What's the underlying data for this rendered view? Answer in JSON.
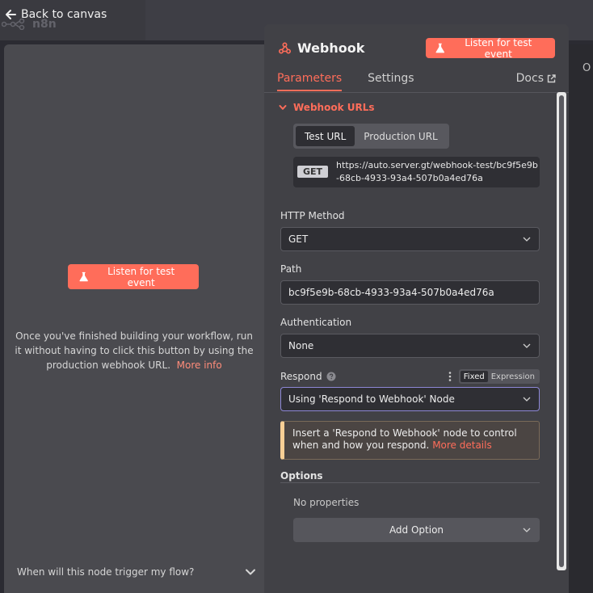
{
  "topbar": {
    "back_label": "Back to canvas",
    "logo_text": "n8n"
  },
  "left_panel": {
    "listen_button": "Listen for test event",
    "description": "Once you've finished building your workflow, run it without having to click this button by using the production webhook URL.",
    "more_info": "More info",
    "footer_question": "When will this node trigger my flow?"
  },
  "right_edge": {
    "letter": "O"
  },
  "node": {
    "title": "Webhook",
    "listen_button": "Listen for test event",
    "tabs": [
      {
        "label": "Parameters",
        "active": true
      },
      {
        "label": "Settings",
        "active": false
      }
    ],
    "docs_label": "Docs"
  },
  "webhook_urls": {
    "section_label": "Webhook URLs",
    "tabs": [
      {
        "label": "Test URL",
        "active": true
      },
      {
        "label": "Production URL",
        "active": false
      }
    ],
    "method_badge": "GET",
    "url": "https://auto.server.gt/webhook-test/bc9f5e9b-68cb-4933-93a4-507b0a4ed76a"
  },
  "fields": {
    "http_method": {
      "label": "HTTP Method",
      "value": "GET"
    },
    "path": {
      "label": "Path",
      "value": "bc9f5e9b-68cb-4933-93a4-507b0a4ed76a"
    },
    "authentication": {
      "label": "Authentication",
      "value": "None"
    },
    "respond": {
      "label": "Respond",
      "value": "Using 'Respond to Webhook' Node",
      "mode_fixed": "Fixed",
      "mode_expression": "Expression"
    }
  },
  "notice": {
    "text": "Insert a 'Respond to Webhook' node to control when and how you respond.",
    "link": "More details"
  },
  "options": {
    "label": "Options",
    "empty_text": "No properties",
    "add_button": "Add Option"
  },
  "colors": {
    "accent": "#ff6d5a",
    "panel": "#414146",
    "warning_border": "#f8cf95"
  }
}
